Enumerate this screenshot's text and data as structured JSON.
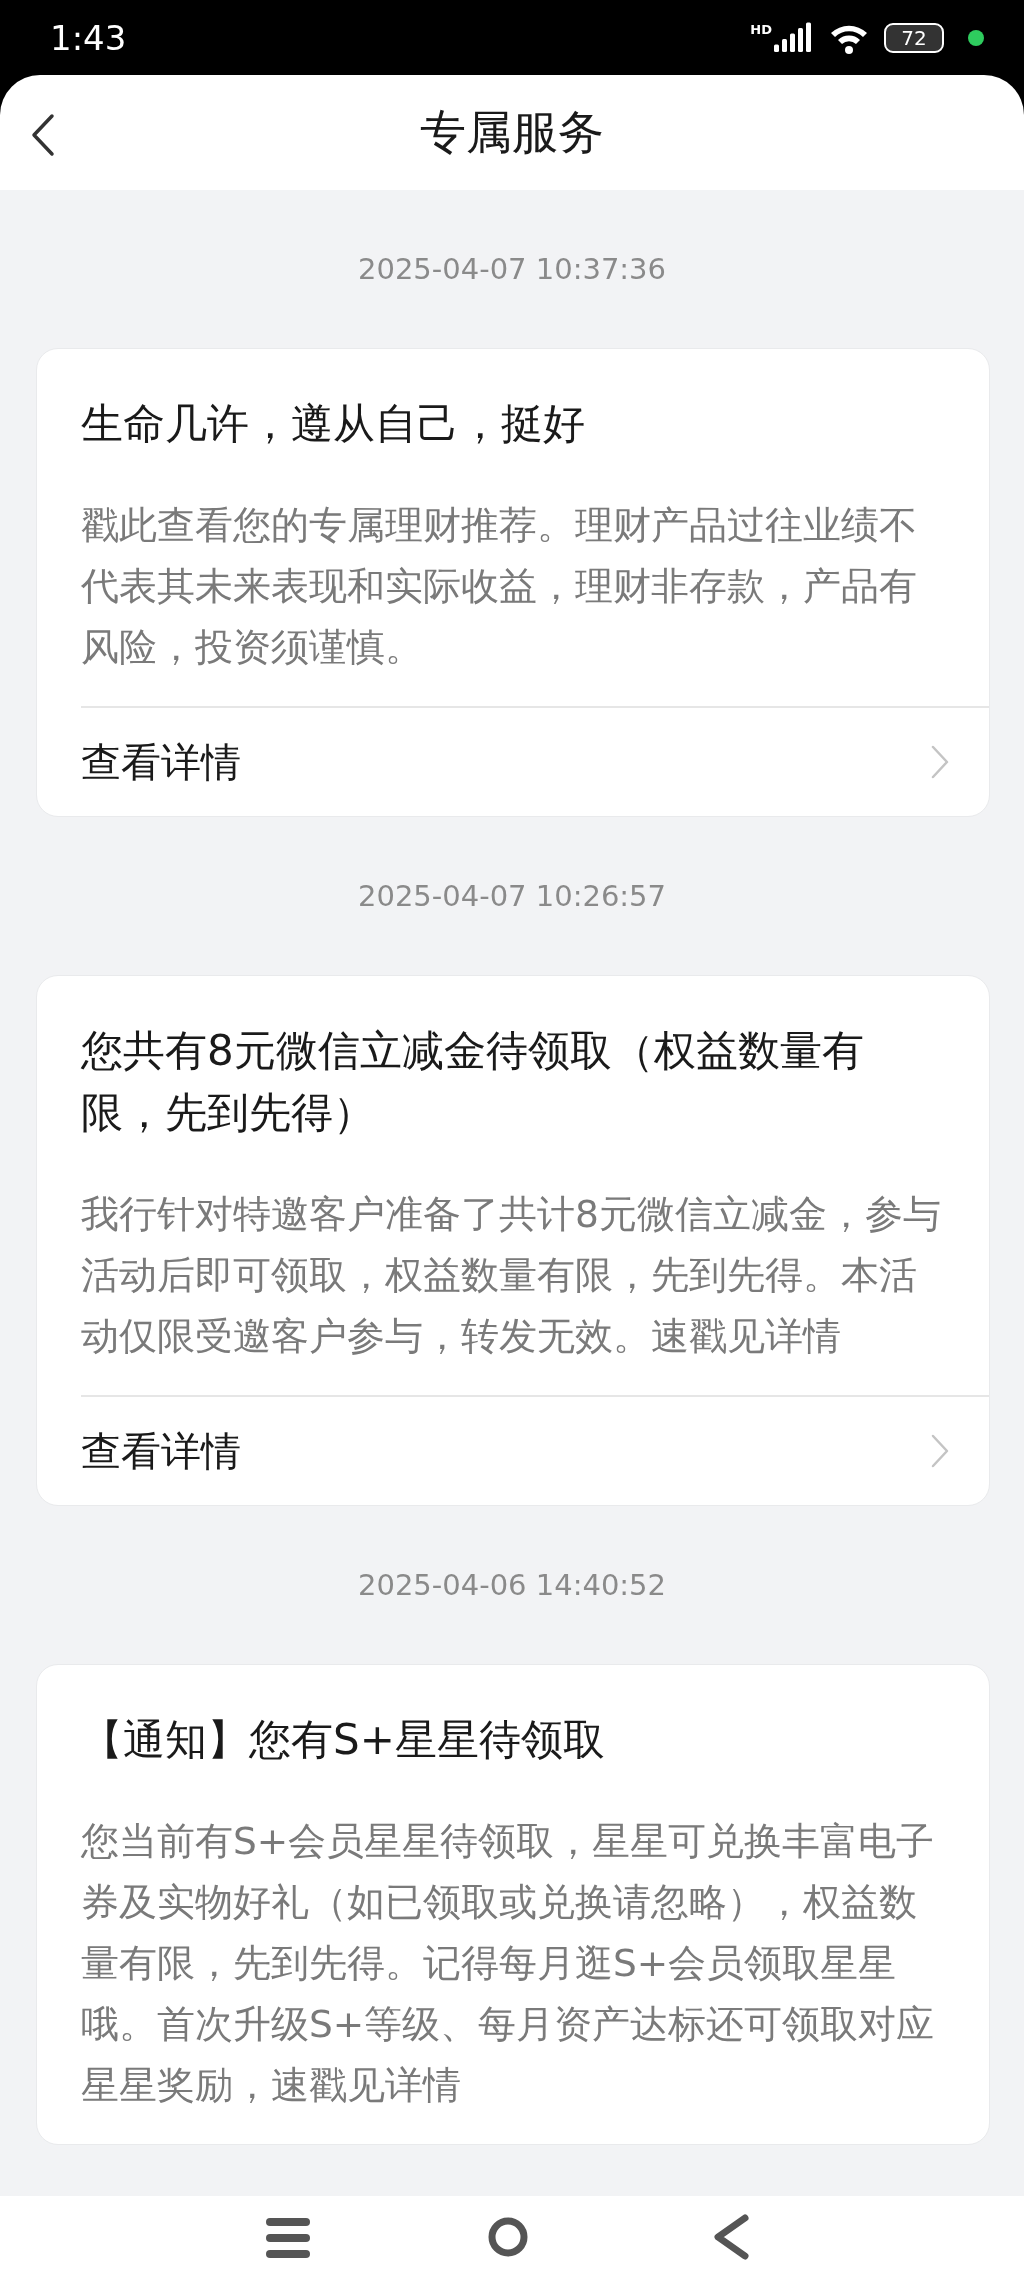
{
  "status_bar": {
    "time": "1:43",
    "network": "HD",
    "battery": "72"
  },
  "header": {
    "title": "专属服务"
  },
  "messages": [
    {
      "timestamp": "2025-04-07 10:37:36",
      "title": "生命几许，遵从自己，挺好",
      "body": "戳此查看您的专属理财推荐。理财产品过往业绩不代表其未来表现和实际收益，理财非存款，产品有风险，投资须谨慎。",
      "link": "查看详情"
    },
    {
      "timestamp": "2025-04-07 10:26:57",
      "title": "您共有8元微信立减金待领取（权益数量有限，先到先得）",
      "body": "我行针对特邀客户准备了共计8元微信立减金，参与活动后即可领取，权益数量有限，先到先得。本活动仅限受邀客户参与，转发无效。速戳见详情",
      "link": "查看详情"
    },
    {
      "timestamp": "2025-04-06 14:40:52",
      "title": "【通知】您有S+星星待领取",
      "body": "您当前有S+会员星星待领取，星星可兑换丰富电子券及实物好礼（如已领取或兑换请忽略），权益数量有限，先到先得。记得每月逛S+会员领取星星哦。首次升级S+等级、每月资产达标还可领取对应星星奖励，速戳见详情"
    }
  ]
}
